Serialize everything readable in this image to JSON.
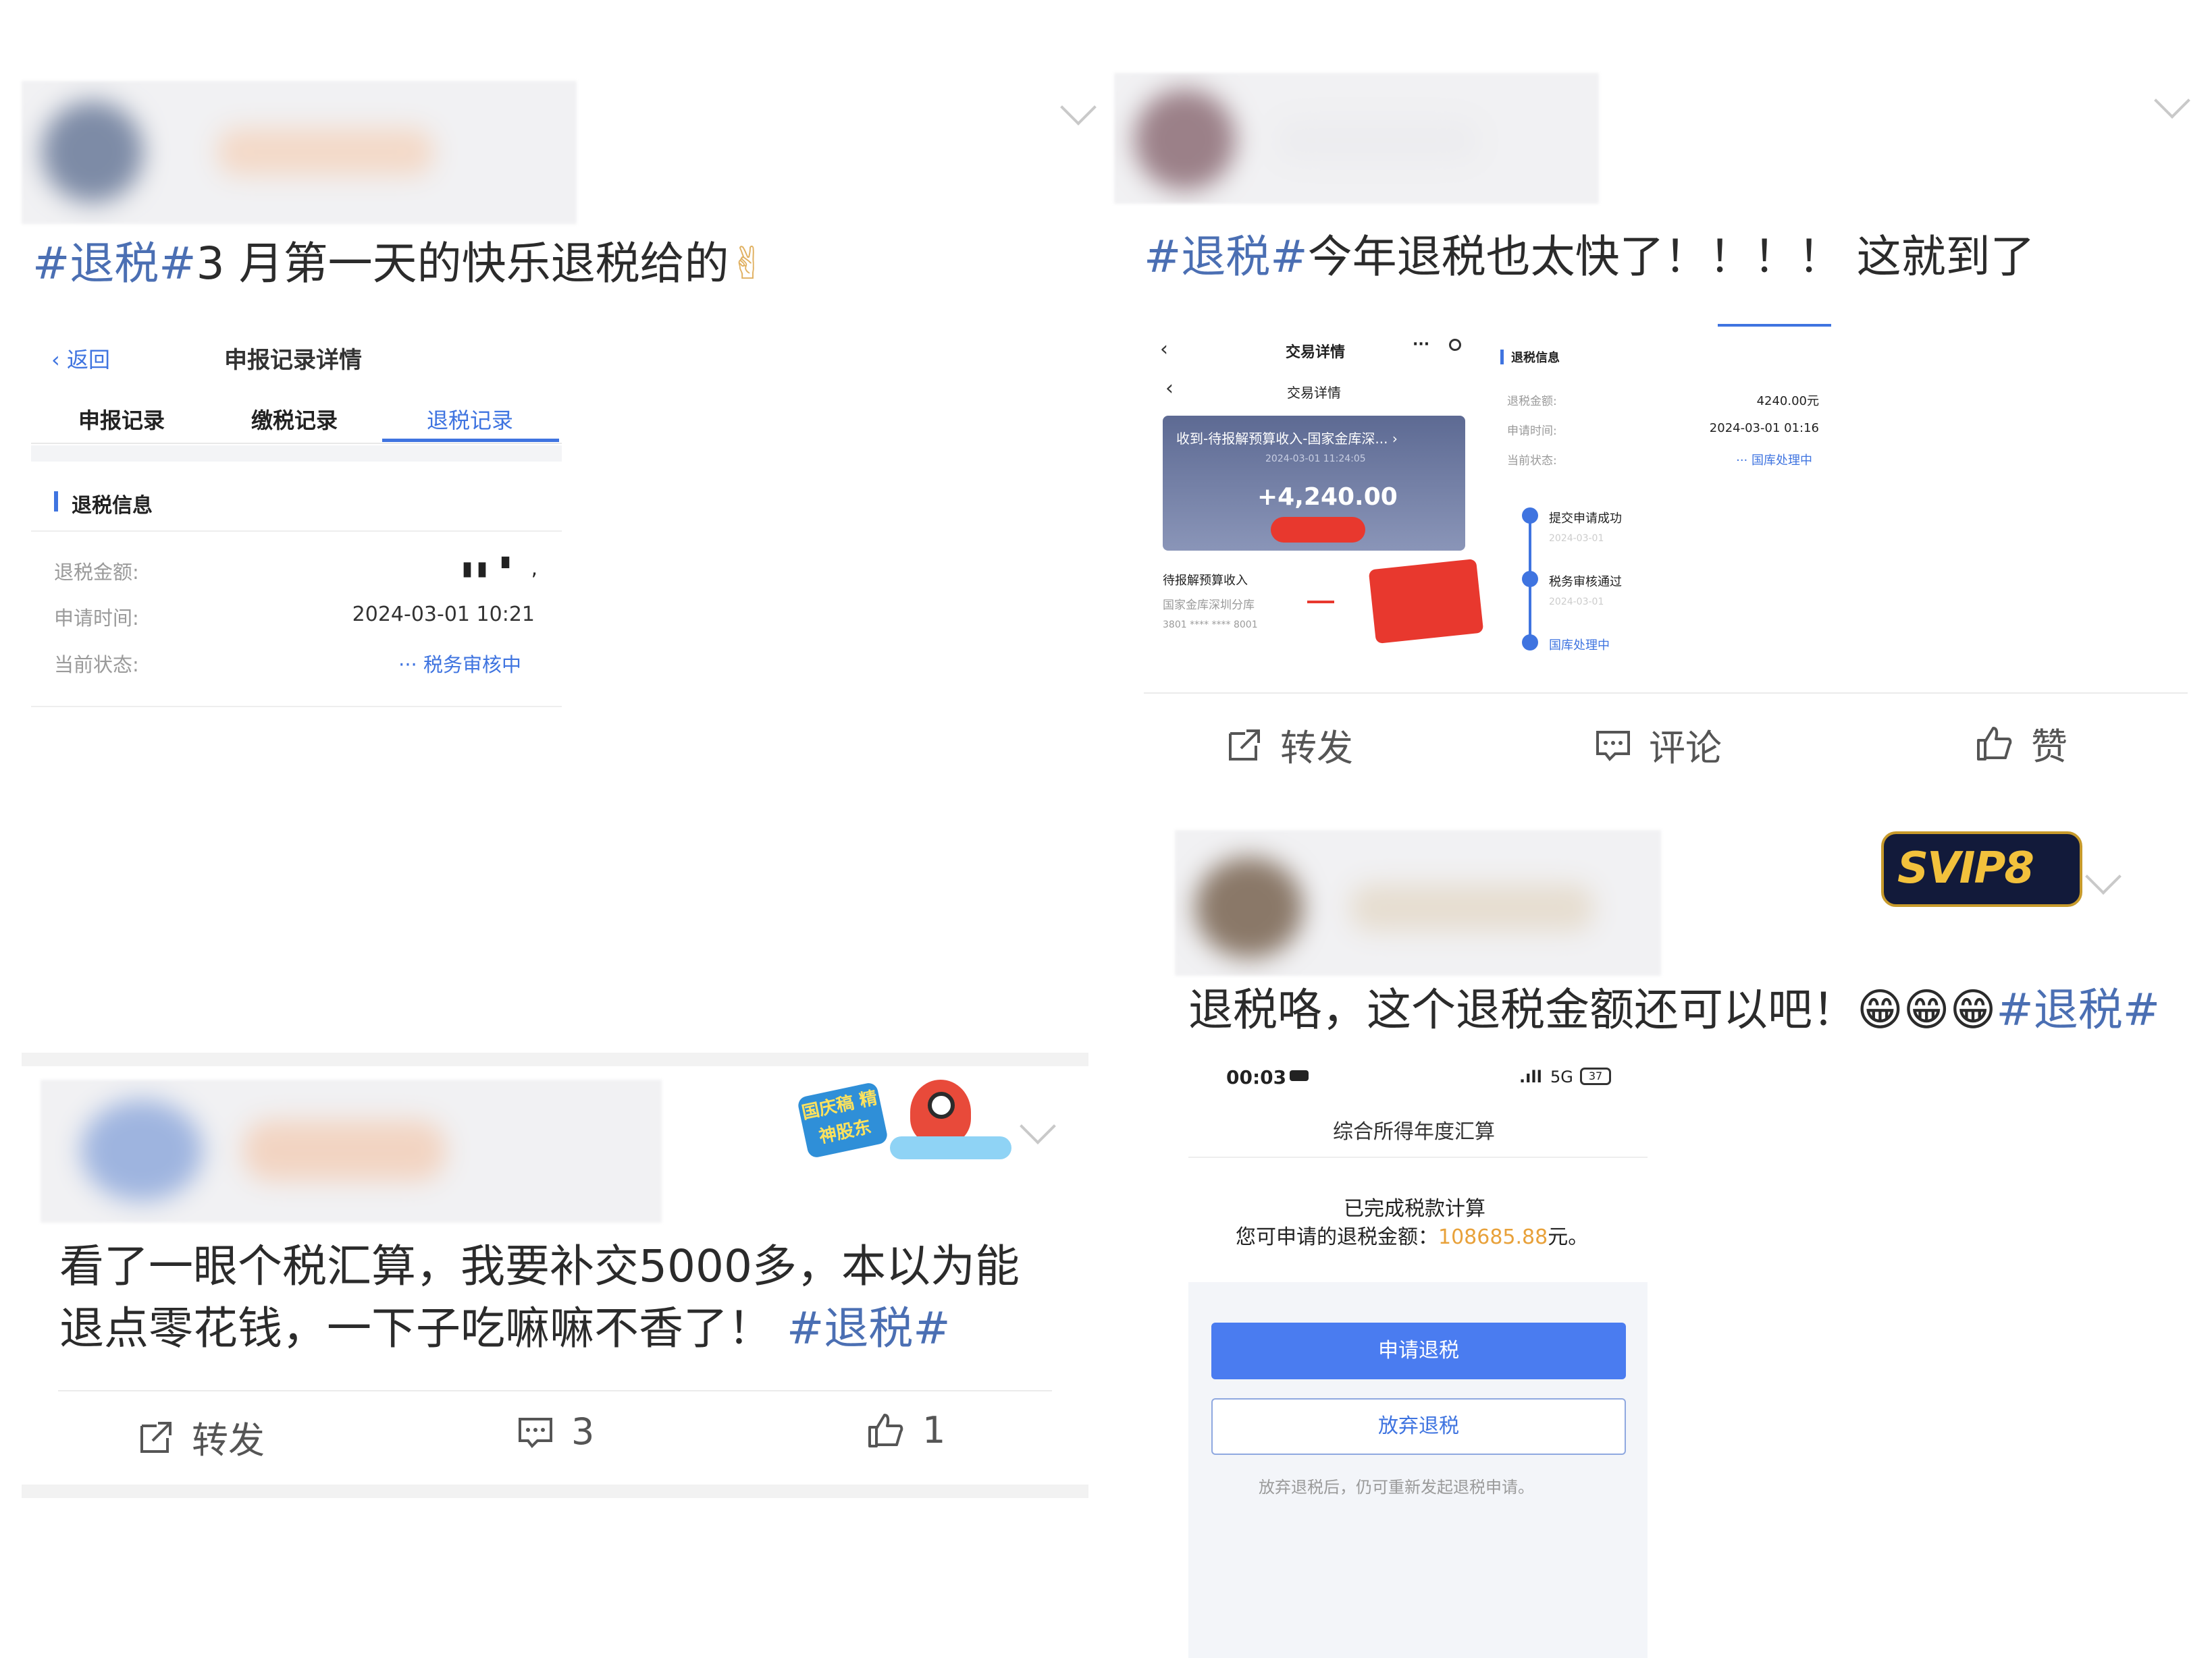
{
  "post1": {
    "tag": "#退税#",
    "text": "3 月第一天的快乐退税给的",
    "emoji": "✌",
    "screenshot": {
      "back": "返回",
      "title": "申报记录详情",
      "tabs": [
        "申报记录",
        "缴税记录",
        "退税记录"
      ],
      "section": "退税信息",
      "rows": [
        {
          "label": "退税金额:",
          "value": "▮▮ ▘ ,"
        },
        {
          "label": "申请时间:",
          "value": "2024-03-01 10:21"
        },
        {
          "label": "当前状态:",
          "value": "··· 税务审核中"
        }
      ]
    }
  },
  "post2": {
    "tag": "#退税#",
    "text": "今年退税也太快了！！！！ 这就到了",
    "left": {
      "title": "交易详情",
      "sub_title": "交易详情",
      "banner": "收到-待报解预算收入-国家金库深...  ›",
      "banner_date": "2024-03-01 11:24:05",
      "amount": "+4,240.00",
      "payer": "待报解预算收入",
      "bank": "国家金库深圳分库",
      "account": "3801 **** **** 8001"
    },
    "right": {
      "section": "退税信息",
      "rows": [
        {
          "label": "退税金额:",
          "value": "4240.00元"
        },
        {
          "label": "申请时间:",
          "value": "2024-03-01 01:16"
        },
        {
          "label": "当前状态:",
          "value": "··· 国库处理中"
        }
      ],
      "steps": [
        {
          "label": "提交申请成功",
          "date": "2024-03-01"
        },
        {
          "label": "税务审核通过",
          "date": "2024-03-01"
        },
        {
          "label": "国库处理中",
          "date": ""
        }
      ]
    },
    "actions": {
      "forward": "转发",
      "comment": "评论",
      "like": "赞"
    }
  },
  "post3": {
    "badge": "国庆稿 精神股东",
    "text_line1": "看了一眼个税汇算，我要补交5000多，本以为能",
    "text_line2": "退点零花钱，一下子吃嘛嘛不香了！",
    "tag": "#退税#",
    "actions": {
      "forward": "转发",
      "comment": "3",
      "like": "1"
    }
  },
  "post4": {
    "badge": "SVIP8",
    "text": "退税咯，这个退税金额还可以吧！",
    "emojis": "😁😁😁",
    "tag": "#退税#",
    "phone": {
      "time": "00:03",
      "network": "5G",
      "battery": "37",
      "title": "综合所得年度汇算",
      "done": "已完成税款计算",
      "amount_prefix": "您可申请的退税金额：",
      "amount": "108685.88",
      "amount_suffix": "元。",
      "apply_button": "申请退税",
      "give_up_button": "放弃退税",
      "note": "放弃退税后，仍可重新发起退税申请。"
    }
  },
  "colors": {
    "link": "#4b6fb3",
    "primary": "#4a7cf0",
    "amount": "#e8a13a",
    "redact": "#e8382e"
  }
}
